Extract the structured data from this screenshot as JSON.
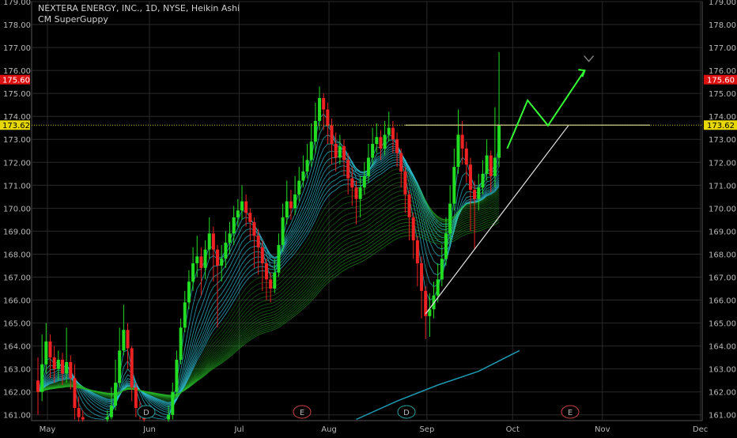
{
  "legend": {
    "symbol_line": "NEXTERA ENERGY, INC., 1D, NYSE, Heikin Ashi",
    "indicator": "CM SuperGuppy"
  },
  "colors": {
    "up": "#22dd22",
    "down": "#ee2222",
    "grid": "#2a2a2a",
    "trend": "#e6e6e6",
    "arrow": "#33ff33",
    "marker": "#888888",
    "ema200": "#1e9ab0",
    "last_price_bg": "#dd1111",
    "level_bg": "#e6d800"
  },
  "chart_data": {
    "type": "candlestick",
    "title": "NEXTERA ENERGY, INC., 1D, NYSE, Heikin Ashi",
    "ylim": [
      160.75,
      179.0
    ],
    "y_ticks": [
      "161.00",
      "162.00",
      "163.00",
      "164.00",
      "165.00",
      "166.00",
      "167.00",
      "168.00",
      "169.00",
      "170.00",
      "171.00",
      "172.00",
      "173.00",
      "174.00",
      "175.00",
      "176.00",
      "177.00",
      "178.00",
      "179.00"
    ],
    "x_ticks": [
      "May",
      "Jun",
      "Jul",
      "Aug",
      "Sep",
      "Oct",
      "Nov",
      "Dec"
    ],
    "price_labels": {
      "last": "175.60",
      "level": "173.62"
    },
    "horizontal_level": 173.62,
    "events": [
      "D",
      "E",
      "D",
      "E"
    ],
    "candles": [
      {
        "o": 162.5,
        "c": 162.0,
        "h": 163.5,
        "l": 161.0
      },
      {
        "o": 162.0,
        "c": 163.2,
        "h": 164.5,
        "l": 161.6
      },
      {
        "o": 163.2,
        "c": 164.2,
        "h": 165.0,
        "l": 162.8
      },
      {
        "o": 164.2,
        "c": 163.5,
        "h": 164.5,
        "l": 162.6
      },
      {
        "o": 163.5,
        "c": 163.0,
        "h": 164.0,
        "l": 162.4
      },
      {
        "o": 163.0,
        "c": 163.4,
        "h": 163.8,
        "l": 162.5
      },
      {
        "o": 163.4,
        "c": 162.8,
        "h": 163.7,
        "l": 162.3
      },
      {
        "o": 162.8,
        "c": 163.3,
        "h": 164.8,
        "l": 162.4
      },
      {
        "o": 163.3,
        "c": 162.6,
        "h": 163.6,
        "l": 162.1
      },
      {
        "o": 162.6,
        "c": 161.3,
        "h": 163.2,
        "l": 160.8
      },
      {
        "o": 161.3,
        "c": 160.9,
        "h": 161.8,
        "l": 160.7
      },
      {
        "o": 160.9,
        "c": 160.8,
        "h": 161.2,
        "l": 160.7
      },
      {
        "o": 160.8,
        "c": 160.8,
        "h": 161.0,
        "l": 160.7
      },
      {
        "o": 160.8,
        "c": 160.8,
        "h": 161.0,
        "l": 160.7
      },
      {
        "o": 160.8,
        "c": 160.8,
        "h": 161.0,
        "l": 160.7
      },
      {
        "o": 160.8,
        "c": 160.8,
        "h": 161.0,
        "l": 160.7
      },
      {
        "o": 160.8,
        "c": 160.8,
        "h": 161.0,
        "l": 160.7
      },
      {
        "o": 160.8,
        "c": 160.9,
        "h": 161.2,
        "l": 160.7
      },
      {
        "o": 160.9,
        "c": 161.4,
        "h": 162.2,
        "l": 160.8
      },
      {
        "o": 161.4,
        "c": 162.4,
        "h": 163.4,
        "l": 161.2
      },
      {
        "o": 162.4,
        "c": 163.8,
        "h": 164.8,
        "l": 162.2
      },
      {
        "o": 163.8,
        "c": 164.7,
        "h": 165.8,
        "l": 163.6
      },
      {
        "o": 164.7,
        "c": 163.9,
        "h": 165.0,
        "l": 163.0
      },
      {
        "o": 163.9,
        "c": 162.2,
        "h": 164.0,
        "l": 161.6
      },
      {
        "o": 162.2,
        "c": 161.3,
        "h": 162.4,
        "l": 160.9
      },
      {
        "o": 161.3,
        "c": 161.0,
        "h": 161.6,
        "l": 160.8
      },
      {
        "o": 161.0,
        "c": 160.8,
        "h": 161.3,
        "l": 160.7
      },
      {
        "o": 160.8,
        "c": 160.8,
        "h": 161.0,
        "l": 160.7
      },
      {
        "o": 160.8,
        "c": 160.8,
        "h": 161.0,
        "l": 160.7
      },
      {
        "o": 160.8,
        "c": 160.8,
        "h": 161.0,
        "l": 160.7
      },
      {
        "o": 160.8,
        "c": 160.8,
        "h": 161.0,
        "l": 160.7
      },
      {
        "o": 160.8,
        "c": 160.8,
        "h": 161.0,
        "l": 160.7
      },
      {
        "o": 160.8,
        "c": 161.0,
        "h": 161.4,
        "l": 160.7
      },
      {
        "o": 161.0,
        "c": 162.0,
        "h": 162.4,
        "l": 160.8
      },
      {
        "o": 162.0,
        "c": 163.4,
        "h": 163.8,
        "l": 161.8
      },
      {
        "o": 163.4,
        "c": 164.8,
        "h": 165.2,
        "l": 163.2
      },
      {
        "o": 164.8,
        "c": 165.9,
        "h": 166.4,
        "l": 164.6
      },
      {
        "o": 165.9,
        "c": 166.8,
        "h": 167.3,
        "l": 165.6
      },
      {
        "o": 166.8,
        "c": 167.6,
        "h": 168.3,
        "l": 166.4
      },
      {
        "o": 167.6,
        "c": 167.9,
        "h": 168.8,
        "l": 167.0
      },
      {
        "o": 167.9,
        "c": 167.4,
        "h": 168.3,
        "l": 166.2
      },
      {
        "o": 167.4,
        "c": 168.2,
        "h": 168.6,
        "l": 166.9
      },
      {
        "o": 168.2,
        "c": 168.9,
        "h": 169.6,
        "l": 167.8
      },
      {
        "o": 168.9,
        "c": 168.2,
        "h": 169.2,
        "l": 166.8
      },
      {
        "o": 168.2,
        "c": 167.5,
        "h": 168.4,
        "l": 164.8
      },
      {
        "o": 167.5,
        "c": 167.8,
        "h": 168.4,
        "l": 166.8
      },
      {
        "o": 167.8,
        "c": 168.5,
        "h": 169.0,
        "l": 167.4
      },
      {
        "o": 168.5,
        "c": 168.9,
        "h": 169.4,
        "l": 168.0
      },
      {
        "o": 168.9,
        "c": 169.6,
        "h": 170.1,
        "l": 168.4
      },
      {
        "o": 169.6,
        "c": 169.9,
        "h": 170.4,
        "l": 169.2
      },
      {
        "o": 169.9,
        "c": 170.3,
        "h": 171.0,
        "l": 169.5
      },
      {
        "o": 170.3,
        "c": 169.8,
        "h": 170.6,
        "l": 169.2
      },
      {
        "o": 169.8,
        "c": 169.4,
        "h": 170.0,
        "l": 168.6
      },
      {
        "o": 169.4,
        "c": 168.8,
        "h": 169.6,
        "l": 167.4
      },
      {
        "o": 168.8,
        "c": 168.3,
        "h": 169.1,
        "l": 167.1
      },
      {
        "o": 168.3,
        "c": 167.6,
        "h": 168.6,
        "l": 166.4
      },
      {
        "o": 167.6,
        "c": 166.9,
        "h": 167.8,
        "l": 166.0
      },
      {
        "o": 166.9,
        "c": 166.5,
        "h": 167.2,
        "l": 165.9
      },
      {
        "o": 166.5,
        "c": 167.2,
        "h": 167.8,
        "l": 166.3
      },
      {
        "o": 167.2,
        "c": 168.4,
        "h": 168.9,
        "l": 167.0
      },
      {
        "o": 168.4,
        "c": 169.6,
        "h": 170.2,
        "l": 168.1
      },
      {
        "o": 169.6,
        "c": 170.3,
        "h": 171.2,
        "l": 169.3
      },
      {
        "o": 170.3,
        "c": 170.0,
        "h": 170.8,
        "l": 169.5
      },
      {
        "o": 170.0,
        "c": 170.6,
        "h": 171.4,
        "l": 169.7
      },
      {
        "o": 170.6,
        "c": 171.2,
        "h": 171.8,
        "l": 170.3
      },
      {
        "o": 171.2,
        "c": 171.6,
        "h": 172.3,
        "l": 170.9
      },
      {
        "o": 171.6,
        "c": 172.1,
        "h": 172.8,
        "l": 171.3
      },
      {
        "o": 172.1,
        "c": 172.9,
        "h": 173.7,
        "l": 171.8
      },
      {
        "o": 172.9,
        "c": 173.8,
        "h": 174.6,
        "l": 172.4
      },
      {
        "o": 173.8,
        "c": 174.8,
        "h": 175.3,
        "l": 173.4
      },
      {
        "o": 174.8,
        "c": 174.3,
        "h": 175.0,
        "l": 173.4
      },
      {
        "o": 174.3,
        "c": 173.6,
        "h": 174.6,
        "l": 172.8
      },
      {
        "o": 173.6,
        "c": 172.8,
        "h": 173.9,
        "l": 171.9
      },
      {
        "o": 172.8,
        "c": 172.2,
        "h": 173.3,
        "l": 171.6
      },
      {
        "o": 172.2,
        "c": 172.7,
        "h": 173.2,
        "l": 171.9
      },
      {
        "o": 172.7,
        "c": 172.1,
        "h": 173.0,
        "l": 171.4
      },
      {
        "o": 172.1,
        "c": 171.3,
        "h": 172.4,
        "l": 170.6
      },
      {
        "o": 171.3,
        "c": 170.9,
        "h": 171.8,
        "l": 170.1
      },
      {
        "o": 170.9,
        "c": 170.4,
        "h": 171.2,
        "l": 169.3
      },
      {
        "o": 170.4,
        "c": 170.9,
        "h": 171.4,
        "l": 169.6
      },
      {
        "o": 170.9,
        "c": 171.4,
        "h": 172.0,
        "l": 170.6
      },
      {
        "o": 171.4,
        "c": 172.2,
        "h": 172.8,
        "l": 171.1
      },
      {
        "o": 172.2,
        "c": 172.8,
        "h": 173.5,
        "l": 171.9
      },
      {
        "o": 172.8,
        "c": 173.1,
        "h": 173.7,
        "l": 172.4
      },
      {
        "o": 173.1,
        "c": 172.6,
        "h": 173.4,
        "l": 172.1
      },
      {
        "o": 172.6,
        "c": 173.2,
        "h": 173.8,
        "l": 172.3
      },
      {
        "o": 173.2,
        "c": 173.5,
        "h": 174.2,
        "l": 172.9
      },
      {
        "o": 173.5,
        "c": 173.0,
        "h": 173.8,
        "l": 172.4
      },
      {
        "o": 173.0,
        "c": 172.4,
        "h": 173.3,
        "l": 171.8
      },
      {
        "o": 172.4,
        "c": 171.6,
        "h": 172.6,
        "l": 170.9
      },
      {
        "o": 171.6,
        "c": 170.6,
        "h": 171.8,
        "l": 169.8
      },
      {
        "o": 170.6,
        "c": 169.6,
        "h": 170.8,
        "l": 168.6
      },
      {
        "o": 169.6,
        "c": 168.6,
        "h": 169.8,
        "l": 167.8
      },
      {
        "o": 168.6,
        "c": 167.6,
        "h": 168.8,
        "l": 166.6
      },
      {
        "o": 167.6,
        "c": 166.4,
        "h": 167.9,
        "l": 165.2
      },
      {
        "o": 166.4,
        "c": 165.3,
        "h": 166.6,
        "l": 164.3
      },
      {
        "o": 165.3,
        "c": 165.6,
        "h": 166.3,
        "l": 164.4
      },
      {
        "o": 165.6,
        "c": 166.2,
        "h": 166.8,
        "l": 165.2
      },
      {
        "o": 166.2,
        "c": 166.9,
        "h": 167.6,
        "l": 165.9
      },
      {
        "o": 166.9,
        "c": 167.8,
        "h": 168.4,
        "l": 166.6
      },
      {
        "o": 167.8,
        "c": 168.9,
        "h": 169.6,
        "l": 167.5
      },
      {
        "o": 168.9,
        "c": 170.2,
        "h": 171.0,
        "l": 168.6
      },
      {
        "o": 170.2,
        "c": 171.8,
        "h": 172.6,
        "l": 169.9
      },
      {
        "o": 171.8,
        "c": 173.2,
        "h": 174.3,
        "l": 171.5
      },
      {
        "o": 173.2,
        "c": 172.6,
        "h": 173.8,
        "l": 171.9
      },
      {
        "o": 172.6,
        "c": 171.9,
        "h": 172.9,
        "l": 171.1
      },
      {
        "o": 171.9,
        "c": 170.8,
        "h": 172.2,
        "l": 169.0
      },
      {
        "o": 170.8,
        "c": 170.4,
        "h": 171.2,
        "l": 168.2
      },
      {
        "o": 170.4,
        "c": 170.9,
        "h": 171.5,
        "l": 169.9
      },
      {
        "o": 170.9,
        "c": 171.5,
        "h": 172.1,
        "l": 170.6
      },
      {
        "o": 171.5,
        "c": 172.3,
        "h": 173.0,
        "l": 171.2
      },
      {
        "o": 172.3,
        "c": 171.4,
        "h": 172.5,
        "l": 170.7
      },
      {
        "o": 171.4,
        "c": 172.2,
        "h": 174.4,
        "l": 170.9
      },
      {
        "o": 172.2,
        "c": 173.6,
        "h": 176.8,
        "l": 171.8
      }
    ],
    "overlays": {
      "trend_line": [
        [
          95,
          165.4
        ],
        [
          118,
          170.9
        ],
        [
          130,
          173.6
        ]
      ],
      "forecast_arrows": [
        [
          115,
          172.6
        ],
        [
          120,
          174.7
        ],
        [
          125,
          173.6
        ],
        [
          134,
          176.0
        ]
      ],
      "forecast_marker": [
        135,
        176.5
      ],
      "ema200": [
        [
          78,
          160.8
        ],
        [
          88,
          161.6
        ],
        [
          98,
          162.3
        ],
        [
          108,
          162.9
        ],
        [
          118,
          163.8
        ]
      ]
    }
  }
}
